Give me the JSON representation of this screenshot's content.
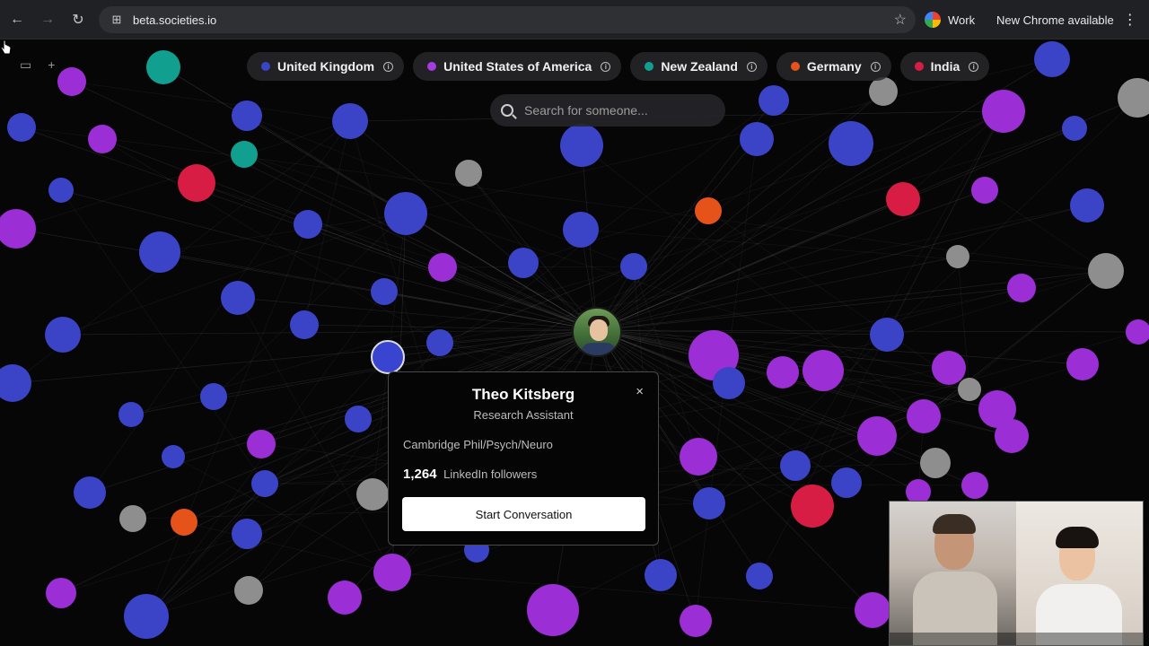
{
  "browser": {
    "url": "beta.societies.io",
    "profile_name": "Work",
    "update_label": "New Chrome available"
  },
  "filters": [
    {
      "label": "United Kingdom",
      "color": "#3b43c6"
    },
    {
      "label": "United States of America",
      "color": "#a43ce0"
    },
    {
      "label": "New Zealand",
      "color": "#11a08f"
    },
    {
      "label": "Germany",
      "color": "#e5531b"
    },
    {
      "label": "India",
      "color": "#d81d45"
    }
  ],
  "search": {
    "placeholder": "Search for someone..."
  },
  "profile_card": {
    "name": "Theo Kitsberg",
    "role": "Research Assistant",
    "school": "Cambridge Phil/Psych/Neuro",
    "followers_count": "1,264",
    "followers_label": "LinkedIn followers",
    "cta_label": "Start Conversation",
    "close_glyph": "×"
  },
  "icons": {
    "back": "←",
    "forward": "→",
    "reload": "↻",
    "site_info": "⊞",
    "star": "☆",
    "kebab": "⋮",
    "sidebar": "▭",
    "add": "+",
    "info": "i"
  },
  "graph_colors": {
    "uk": "#3b43c6",
    "usa": "#9b2fd5",
    "nz": "#11a08f",
    "de": "#e5531b",
    "in": "#d81d45",
    "unknown": "#8e8e8e"
  }
}
